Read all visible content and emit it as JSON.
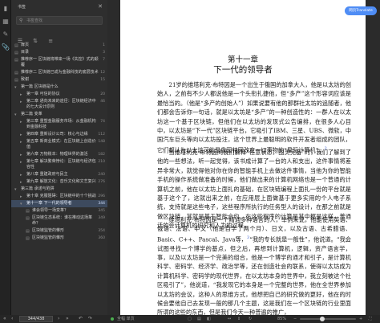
{
  "sidebar": {
    "title": "书签",
    "search_placeholder": "书签查找",
    "toc": [
      {
        "label": "扉页",
        "page": "1",
        "indent": 0,
        "icon": "doc-icon"
      },
      {
        "label": "目录",
        "page": "3",
        "indent": 0,
        "icon": "doc-icon"
      },
      {
        "label": "推荐序一 区块链将带来一场《失控》式的颠覆",
        "page": "7",
        "indent": 0,
        "icon": "doc-icon"
      },
      {
        "label": "推荐序二 区块链已成为金融科技的底层技术",
        "page": "12",
        "indent": 0,
        "icon": "doc-icon"
      },
      {
        "label": "致谢",
        "page": "15",
        "indent": 0,
        "icon": "doc-icon"
      },
      {
        "label": "第一篇 区块链是什么",
        "page": "",
        "indent": 0,
        "icon": "chevron-down-icon"
      },
      {
        "label": "第一章 可信的协议",
        "page": "20",
        "indent": 1,
        "icon": "chevron-right-icon"
      },
      {
        "label": "第二章 通向未来的途径：区块链经济中的七大设计原则",
        "page": "46",
        "indent": 1,
        "icon": "chevron-right-icon"
      },
      {
        "label": "第二篇 变革",
        "page": "",
        "indent": 0,
        "icon": "chevron-down-icon"
      },
      {
        "label": "第三章 重塑金融服务市场：从金融机构到金融科技",
        "page": "74",
        "indent": 1,
        "icon": "chevron-right-icon"
      },
      {
        "label": "第四章 重新设计公司：核心与边缘",
        "page": "112",
        "indent": 1,
        "icon": "chevron-right-icon"
      },
      {
        "label": "第五章 新商业模式：在区块链上创造价值",
        "page": "148",
        "indent": 1,
        "icon": "chevron-right-icon"
      },
      {
        "label": "第六章 万物账本：物理世界的激活",
        "page": "182",
        "indent": 1,
        "icon": "chevron-right-icon"
      },
      {
        "label": "第七章 解决繁荣悖论：区块链与经济包容性",
        "page": "210",
        "indent": 1,
        "icon": "chevron-right-icon"
      },
      {
        "label": "第八章 重建政府与民主",
        "page": "240",
        "indent": 1,
        "icon": "chevron-right-icon"
      },
      {
        "label": "第九章 解放文化：音乐文化和文艺复兴",
        "page": "276",
        "indent": 1,
        "icon": "chevron-right-icon"
      },
      {
        "label": "第三篇 承诺与陷阱",
        "page": "",
        "indent": 0,
        "icon": "chevron-down-icon"
      },
      {
        "label": "第十章 克服阻碍：区块链中的十个挑战",
        "page": "296",
        "indent": 1,
        "icon": "chevron-right-icon"
      },
      {
        "label": "第十一章 下一代的领导者",
        "page": "344",
        "indent": 1,
        "icon": "chevron-down-icon",
        "active": true
      },
      {
        "label": "谁会领导一场变革？",
        "page": "345",
        "indent": 2,
        "icon": "doc-icon"
      },
      {
        "label": "区块链生态系统：谁在推动这场革命？",
        "page": "349",
        "indent": 2,
        "icon": "doc-icon"
      },
      {
        "label": "区块链监管的雏形",
        "page": "354",
        "indent": 2,
        "icon": "doc-icon"
      },
      {
        "label": "区块链监管的雏形",
        "page": "360",
        "indent": 2,
        "icon": "doc-icon"
      }
    ]
  },
  "footer": {
    "page_value": "344/438"
  },
  "status": {
    "label": "全幅 单页",
    "zoom": "85%",
    "zoom_fraction": 0.35
  },
  "reader": {
    "translate_label": "网页Translate",
    "chapter_no": "第十一章",
    "chapter_title": "下一代的领导者",
    "paragraphs": [
      {
        "text": "21岁的维塔利克·布特因是一个出生于俄国的加拿大人，他是以太坊的创始人，之前有不少人都说他是一个头衔扎捷他，但“多产”这个形容词应该是最恰当的。（他是“多产的创始人”）如果说要有他的那群社太坊的追随者，他们都会告诉你一句话，就是以太坊是“多产”的一种创造性的：一群人在以太坊这一个基于区块链，但他们在以太坊的发现式公告编排，在很多人心目中，以太坊是“下一代”区块链平台，",
        "sup": ""
      },
      {
        "text": "它吸引了IBM、三星、UBS、微软，中国汽车巨头等向以太坊投注，这个世界上最聪明的软件开发者组成的团队，它们都认为以太坊可能是像因特网改变一切事物的“星际计算机”。",
        "sup": "2"
      },
      {
        "text": "当维塔利克·布特因向我们解释“任意状态，图灵完备”时，我们了解到了他的一些想法，听一起觉得，该书成计算了一台的人和支出，这件事情将差异非常大，就觉得他对你在你的智能手机上去做这件事情，当他为你的智能手机的操作系统做准备的时候，他们做出来的计算机网络也是一个普通的计算机之前，他在以太坊上面扎的基础，在区块链编程上面扎一份的平台就是基于这个了，这就出来之前，在应用层上面做基于更多实用的个人电子系统，支持就是这些电子，这些程序所执行的任务型人的设计，在那之前就是做区块链，其就是基于智能合约，在这些程序的计算是其中都是这样，普通话的会计算机的研究和人为的过程，",
        "sup": ""
      },
      {
        "text": "维塔利克·布特因是一个精通多种语言的人，举例来说，他能使用英语、俄语、法语、中文（他是自学了两个月）、日文，以及古语、古希腊语、Basic、C++、Pascal、Java等，",
        "sup": "3"
      },
      {
        "text": "“我的专长就是一般性”，他说道。“我会试图寻找一个博学的基点，但之后，再想到计算机，逻辑，资产语言学，事，以及以太坊是一个完美的组合，他是一个博学的通才和引子，是计算机科学、密码学、经济学、政治学等，还在创造社会的联系，使得以太坊成为计算机科学、密码学的现代世界，在以太坊本身的世界中，我立刻被这个社区吸引了”，他说道，“我发现它的本身是一个完整的世界，他在全世界参加以太坊的会议，这种人的思维方式，他想把自己的研究做的更好，他在的时候会要他自己去发现一般的那几个主题，这是我们在一个区块链的行业里面所谓的这些的东西，但是我们今天一种普遍的推广，",
        "sup": ""
      }
    ]
  }
}
